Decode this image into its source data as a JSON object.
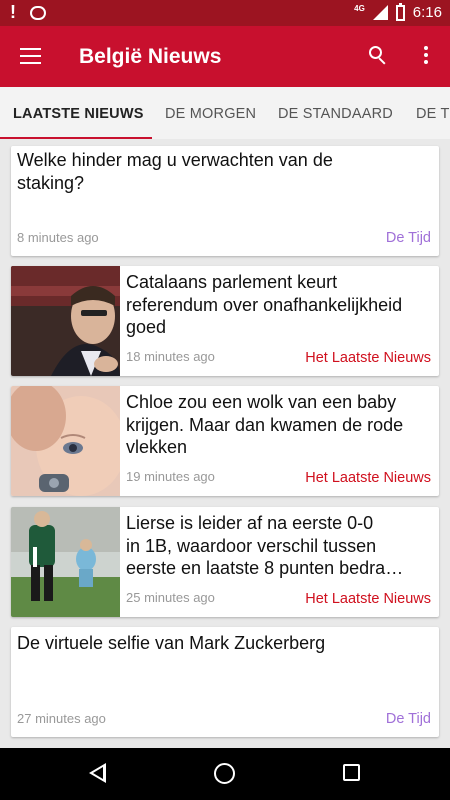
{
  "status_bar": {
    "network": "4G",
    "time": "6:16",
    "icons": [
      "notification-exclamation-icon",
      "chat-notification-icon",
      "signal-icon",
      "battery-icon"
    ]
  },
  "app_bar": {
    "title": "België Nieuws",
    "icons": [
      "menu-icon",
      "search-icon",
      "more-vert-icon"
    ]
  },
  "tabs": [
    {
      "label": "LAATSTE NIEUWS",
      "active": true
    },
    {
      "label": "DE MORGEN",
      "active": false
    },
    {
      "label": "DE STANDAARD",
      "active": false
    },
    {
      "label": "DE TI",
      "active": false
    }
  ],
  "colors": {
    "status_bar": "#9c1421",
    "app_bar": "#c8102e",
    "source_de_tijd": "#a070d8",
    "source_laatste_nieuws": "#d0101e"
  },
  "articles": [
    {
      "headline_lines": [
        "Welke hinder mag u verwachten van de",
        "staking?"
      ],
      "time": "8 minutes ago",
      "source": "De Tijd",
      "has_image": false
    },
    {
      "headline_lines": [
        "Catalaans parlement keurt",
        "referendum over onafhankelijkheid",
        "goed"
      ],
      "time": "18 minutes ago",
      "source": "Het Laatste Nieuws",
      "has_image": true
    },
    {
      "headline_lines": [
        "Chloe zou een wolk van een baby",
        "krijgen. Maar dan kwamen de rode",
        "vlekken"
      ],
      "time": "19 minutes ago",
      "source": "Het Laatste Nieuws",
      "has_image": true
    },
    {
      "headline_lines": [
        "Lierse is leider af na eerste 0-0",
        "in 1B, waardoor verschil tussen",
        "eerste en laatste  8 punten bedra…"
      ],
      "time": "25 minutes ago",
      "source": "Het Laatste Nieuws",
      "has_image": true
    },
    {
      "headline_lines": [
        "De virtuele selfie van Mark Zuckerberg"
      ],
      "time": "27 minutes ago",
      "source": "De Tijd",
      "has_image": false
    }
  ],
  "nav_bar": {
    "icons": [
      "back-icon",
      "home-icon",
      "recents-icon"
    ]
  }
}
